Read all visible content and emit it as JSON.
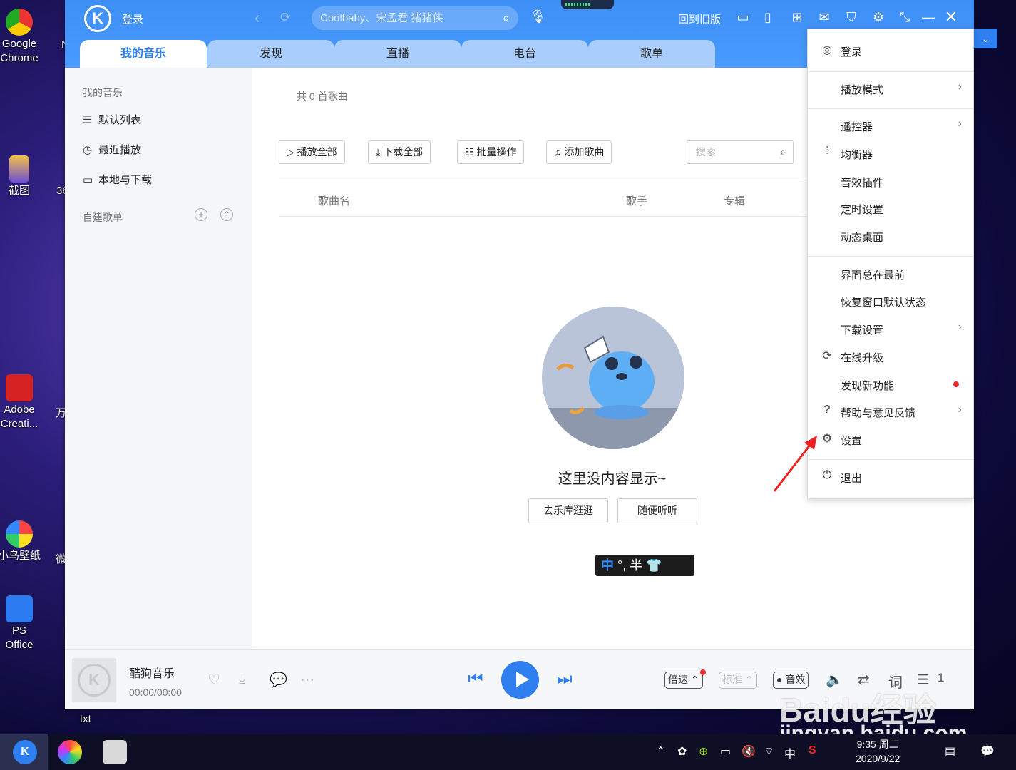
{
  "desktop": {
    "icons": [
      {
        "label_lines": [
          "Google",
          "Chrome"
        ]
      },
      {
        "label_lines": [
          "截图"
        ]
      },
      {
        "label_lines": [
          "Adobe",
          "Creati..."
        ]
      },
      {
        "label_lines": [
          "小鸟壁纸"
        ]
      },
      {
        "label_lines": [
          "PS Office"
        ]
      }
    ],
    "fragments": [
      "N",
      "36",
      "万",
      "微",
      "txt"
    ]
  },
  "app": {
    "header": {
      "login": "登录",
      "search_placeholder": "Coolbaby、宋孟君 猪猪侠",
      "old_version": "回到旧版"
    },
    "tabs": [
      {
        "label": "我的音乐",
        "active": true
      },
      {
        "label": "发现",
        "active": false
      },
      {
        "label": "直播",
        "active": false
      },
      {
        "label": "电台",
        "active": false
      },
      {
        "label": "歌单",
        "active": false
      }
    ],
    "sidebar": {
      "section_title": "我的音乐",
      "items": [
        {
          "icon": "playlist-icon",
          "label": "默认列表"
        },
        {
          "icon": "clock-icon",
          "label": "最近播放"
        },
        {
          "icon": "monitor-icon",
          "label": "本地与下载"
        }
      ],
      "custom_title": "自建歌单"
    },
    "main": {
      "song_count": "共 0 首歌曲",
      "toolbar": {
        "play_all": "播放全部",
        "download_all": "下载全部",
        "batch": "批量操作",
        "add_song": "添加歌曲",
        "search_placeholder": "搜索"
      },
      "columns": {
        "song": "歌曲名",
        "artist": "歌手",
        "album": "专辑"
      },
      "empty": {
        "text": "这里没内容显示~",
        "browse": "去乐库逛逛",
        "random": "随便听听"
      }
    },
    "ime": {
      "zh": "中",
      "rest": "°, 半"
    },
    "player": {
      "title": "酷狗音乐",
      "time": "00:00/00:00",
      "speed": "倍速",
      "quality": "标准",
      "effect": "音效",
      "lyrics": "词",
      "queue_count": "1"
    }
  },
  "menu": {
    "items": [
      {
        "icon": "user-icon",
        "label": "登录",
        "chevron": false
      },
      {
        "icon": "",
        "label": "播放模式",
        "chevron": true
      },
      {
        "icon": "",
        "label": "遥控器",
        "chevron": true
      },
      {
        "icon": "equalizer-icon",
        "label": "均衡器",
        "chevron": false
      },
      {
        "icon": "",
        "label": "音效插件",
        "chevron": false
      },
      {
        "icon": "",
        "label": "定时设置",
        "chevron": false
      },
      {
        "icon": "",
        "label": "动态桌面",
        "chevron": false
      },
      {
        "icon": "",
        "label": "界面总在最前",
        "chevron": false
      },
      {
        "icon": "",
        "label": "恢复窗口默认状态",
        "chevron": false
      },
      {
        "icon": "",
        "label": "下载设置",
        "chevron": true
      },
      {
        "icon": "upgrade-icon",
        "label": "在线升级",
        "chevron": false
      },
      {
        "icon": "",
        "label": "发现新功能",
        "chevron": false,
        "badge": true
      },
      {
        "icon": "help-icon",
        "label": "帮助与意见反馈",
        "chevron": true
      },
      {
        "icon": "gear-icon",
        "label": "设置",
        "chevron": false
      },
      {
        "icon": "power-icon",
        "label": "退出",
        "chevron": false
      }
    ]
  },
  "taskbar": {
    "ime": "中",
    "time": "9:35 周二",
    "date": "2020/9/22"
  },
  "watermark": {
    "brand": "Baidu经验",
    "url": "jingyan.baidu.com"
  },
  "colors": {
    "accent": "#2f7ff0",
    "header": "#4a9bff",
    "badge": "#f12b2b"
  }
}
